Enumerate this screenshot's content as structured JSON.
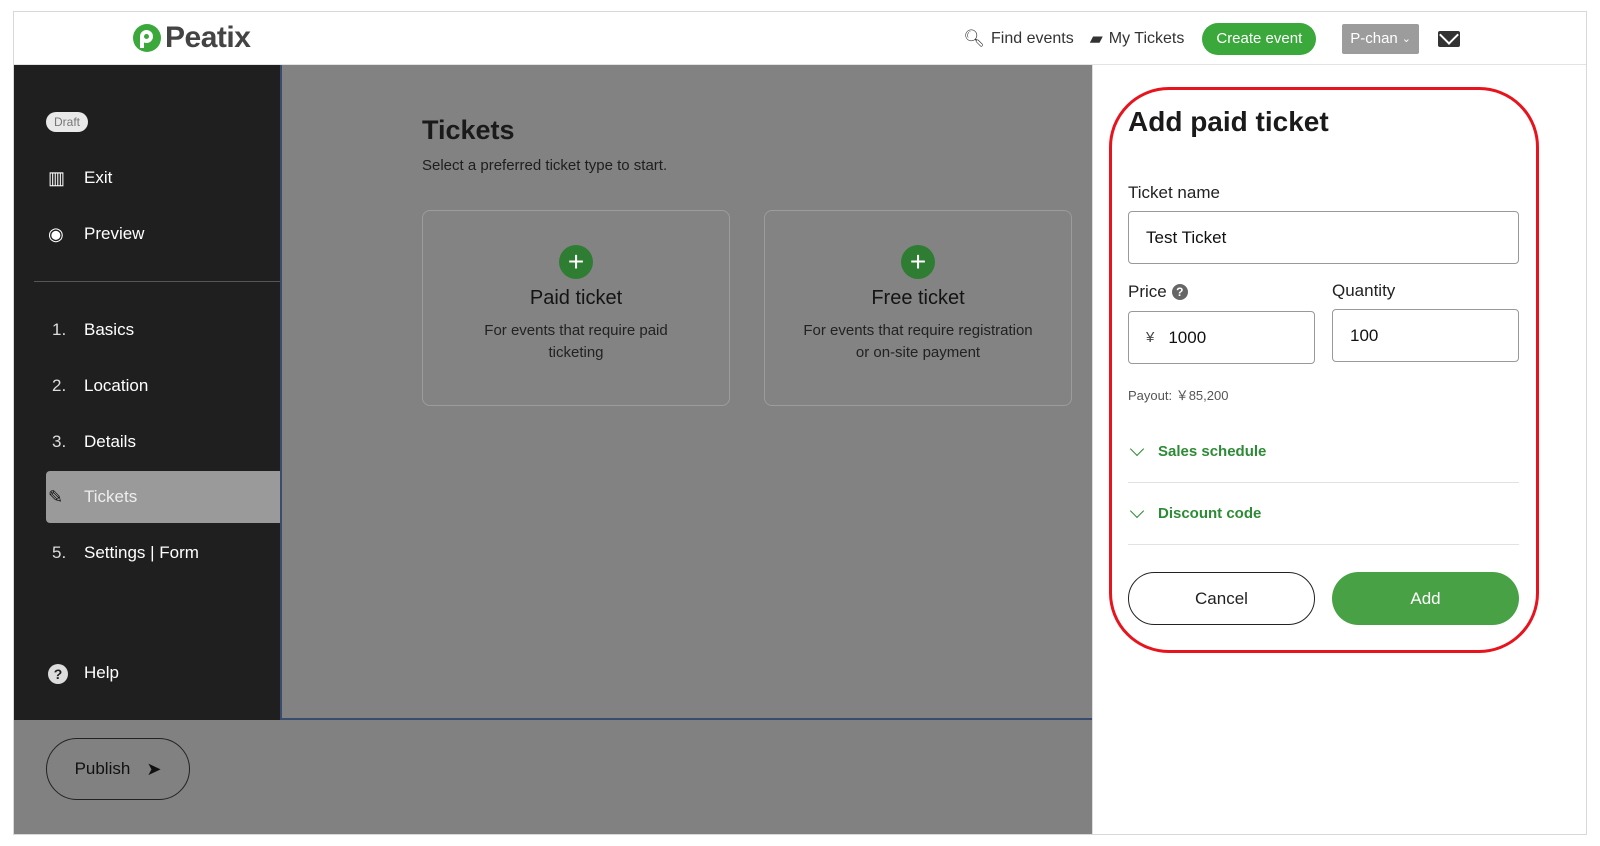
{
  "brand": {
    "name": "Peatix",
    "accent": "#3aa83b"
  },
  "header": {
    "find_events": "Find events",
    "my_tickets": "My Tickets",
    "create_event": "Create event",
    "user": "P-chan"
  },
  "sidebar": {
    "badge": "Draft",
    "exit": "Exit",
    "preview": "Preview",
    "steps": [
      {
        "num": "1.",
        "label": "Basics"
      },
      {
        "num": "2.",
        "label": "Location"
      },
      {
        "num": "3.",
        "label": "Details"
      },
      {
        "num": "",
        "label": "Tickets"
      },
      {
        "num": "5.",
        "label": "Settings | Form"
      }
    ],
    "help": "Help"
  },
  "main": {
    "title": "Tickets",
    "subtitle": "Select a preferred ticket type to start.",
    "cards": [
      {
        "title": "Paid ticket",
        "desc": "For events that require paid ticketing"
      },
      {
        "title": "Free ticket",
        "desc": "For events that require registration or on-site payment"
      }
    ]
  },
  "footer": {
    "publish": "Publish"
  },
  "panel": {
    "title": "Add paid ticket",
    "ticket_name_label": "Ticket name",
    "ticket_name_value": "Test Ticket",
    "price_label": "Price",
    "currency": "¥",
    "price_value": "1000",
    "quantity_label": "Quantity",
    "quantity_value": "100",
    "payout": "Payout: ￥85,200",
    "sales_schedule": "Sales schedule",
    "discount_code": "Discount code",
    "cancel": "Cancel",
    "add": "Add"
  }
}
